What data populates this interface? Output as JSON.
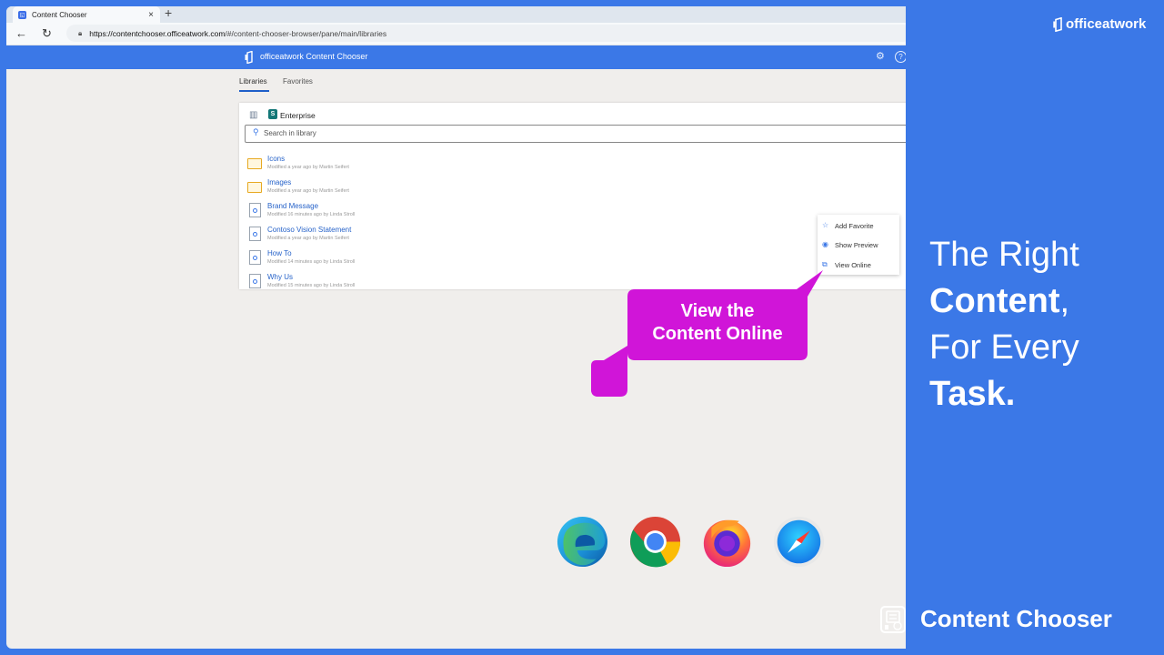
{
  "colors": {
    "brand_blue": "#3b78e7",
    "callout_magenta": "#d015d8",
    "link_blue": "#2763c9"
  },
  "browser": {
    "tab_title": "Content Chooser",
    "tab_close": "×",
    "new_tab": "+",
    "back": "←",
    "reload": "↻",
    "url_domain": "https://contentchooser.officeatwork.com",
    "url_path": "/#/content-chooser-browser/pane/main/libraries"
  },
  "app": {
    "title": "officeatwork Content Chooser",
    "help": "?",
    "settings": "⚙",
    "tabs": [
      {
        "label": "Libraries"
      },
      {
        "label": "Favorites"
      }
    ]
  },
  "library": {
    "name": "Enterprise",
    "sp_letter": "S",
    "more": "⋮",
    "search_placeholder": "Search in library",
    "items": [
      {
        "name": "Icons",
        "meta": "Modified a year ago by Martin Seifert",
        "type": "folder"
      },
      {
        "name": "Images",
        "meta": "Modified a year ago by Martin Seifert",
        "type": "folder"
      },
      {
        "name": "Brand Message",
        "meta": "Modified 16 minutes ago by Linda Stroll",
        "type": "doc"
      },
      {
        "name": "Contoso Vision Statement",
        "meta": "Modified a year ago by Martin Seifert",
        "type": "doc"
      },
      {
        "name": "How To",
        "meta": "Modified 14 minutes ago by Linda Stroll",
        "type": "doc"
      },
      {
        "name": "Why Us",
        "meta": "Modified 15 minutes ago by Linda Stroll",
        "type": "doc"
      }
    ]
  },
  "context_menu": {
    "items": [
      {
        "label": "Add Favorite",
        "icon": "star-icon",
        "glyph": "☆"
      },
      {
        "label": "Show Preview",
        "icon": "eye-icon",
        "glyph": "◉"
      },
      {
        "label": "View Online",
        "icon": "open-external-icon",
        "glyph": "⧉"
      }
    ]
  },
  "callout": {
    "line1": "View the",
    "line2": "Content Online"
  },
  "brand": "officeatwork",
  "tagline": {
    "l1": "The Right",
    "l2_bold": "Content",
    "l2_rest": ",",
    "l3": "For Every",
    "l4_bold": "Task."
  },
  "supported_browsers": [
    "edge-icon",
    "chrome-icon",
    "firefox-icon",
    "safari-icon"
  ],
  "product_name": "Content Chooser"
}
